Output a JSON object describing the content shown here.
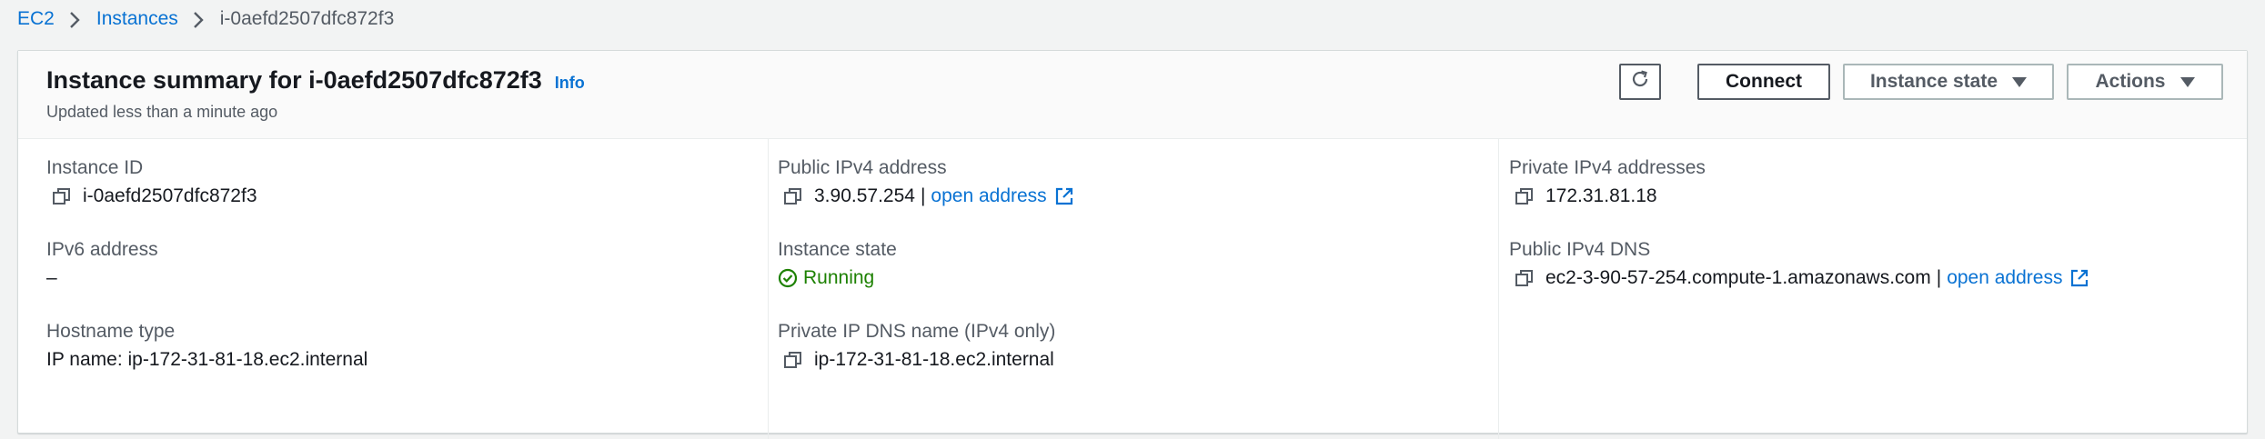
{
  "breadcrumb": {
    "items": [
      "EC2",
      "Instances"
    ],
    "current": "i-0aefd2507dfc872f3"
  },
  "header": {
    "title": "Instance summary for i-0aefd2507dfc872f3",
    "info": "Info",
    "subtitle": "Updated less than a minute ago",
    "buttons": {
      "refresh_icon": "refresh-icon",
      "connect": "Connect",
      "instance_state": "Instance state",
      "actions": "Actions"
    }
  },
  "columns": {
    "left": {
      "instance_id": {
        "label": "Instance ID",
        "value": "i-0aefd2507dfc872f3"
      },
      "ipv6": {
        "label": "IPv6 address",
        "value": "–"
      },
      "hostname": {
        "label": "Hostname type",
        "value": "IP name: ip-172-31-81-18.ec2.internal"
      }
    },
    "middle": {
      "public_ipv4": {
        "label": "Public IPv4 address",
        "value": "3.90.57.254",
        "separator": "|",
        "link": "open address"
      },
      "instance_state": {
        "label": "Instance state",
        "value": "Running"
      },
      "private_dns": {
        "label": "Private IP DNS name (IPv4 only)",
        "value": "ip-172-31-81-18.ec2.internal"
      }
    },
    "right": {
      "private_ipv4": {
        "label": "Private IPv4 addresses",
        "value": "172.31.81.18"
      },
      "public_dns": {
        "label": "Public IPv4 DNS",
        "value": "ec2-3-90-57-254.compute-1.amazonaws.com",
        "separator": "|",
        "link": "open address"
      }
    }
  },
  "colors": {
    "link": "#0972d3",
    "success": "#1d8102",
    "text": "#16191f",
    "muted": "#545b64",
    "background": "#f2f3f3"
  }
}
